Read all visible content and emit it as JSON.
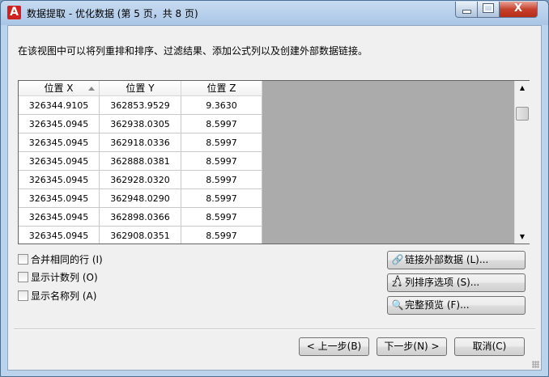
{
  "window": {
    "title": "数据提取 - 优化数据 (第 5 页，共 8 页)",
    "app_icon_letter": "A",
    "close_glyph": "X"
  },
  "description": "在该视图中可以将列重排和排序、过滤结果、添加公式列以及创建外部数据链接。",
  "table": {
    "columns": [
      "位置 X",
      "位置 Y",
      "位置 Z"
    ],
    "rows": [
      [
        "326344.9105",
        "362853.9529",
        "9.3630"
      ],
      [
        "326345.0945",
        "362938.0305",
        "8.5997"
      ],
      [
        "326345.0945",
        "362918.0336",
        "8.5997"
      ],
      [
        "326345.0945",
        "362888.0381",
        "8.5997"
      ],
      [
        "326345.0945",
        "362928.0320",
        "8.5997"
      ],
      [
        "326345.0945",
        "362948.0290",
        "8.5997"
      ],
      [
        "326345.0945",
        "362898.0366",
        "8.5997"
      ],
      [
        "326345.0945",
        "362908.0351",
        "8.5997"
      ]
    ]
  },
  "options": {
    "combine_rows": "合并相同的行 (I)",
    "show_count_column": "显示计数列 (O)",
    "show_name_column": "显示名称列 (A)"
  },
  "actions": {
    "link_external": "链接外部数据 (L)...",
    "sort_options": "列排序选项 (S)...",
    "full_preview": "完整预览 (F)..."
  },
  "footer": {
    "back": "< 上一步(B)",
    "next": "下一步(N) >",
    "cancel": "取消(C)"
  },
  "icons": {
    "link": "link-icon",
    "sort": "sort-az-icon",
    "preview": "magnifier-icon"
  },
  "colors": {
    "grid_empty": "#ababab",
    "title_bar": "#aac6e6",
    "close_button": "#c6412d"
  }
}
